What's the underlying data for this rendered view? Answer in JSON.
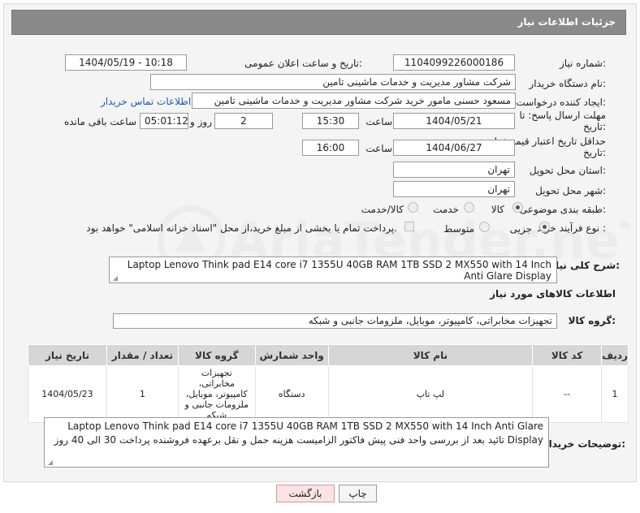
{
  "header": {
    "title": "جزئیات اطلاعات نیاز"
  },
  "labels": {
    "need_number": "شماره نیاز:",
    "announce_datetime": "تاریخ و ساعت اعلان عمومی:",
    "buyer_org": "نام دستگاه خریدار:",
    "requester": "ایجاد کننده درخواست:",
    "reply_deadline": "مهلت ارسال پاسخ: تا تاریخ:",
    "price_validity": "حداقل تاریخ اعتبار قیمت: تا تاریخ:",
    "time": "ساعت",
    "days_and": "روز و",
    "hours_remaining": "ساعت باقی مانده",
    "delivery_province": "استان محل تحویل:",
    "delivery_city": "شهر محل تحویل:",
    "category": "طبقه بندی موضوعی:",
    "purchase_type": "نوع فرآیند خرید :",
    "general_desc": "شرح کلی نیاز:",
    "goods_info": "اطلاعات کالاهای مورد نیاز",
    "goods_group": "گروه کالا:",
    "buyer_notes": "توضیحات خریدار:"
  },
  "values": {
    "need_number": "1104099226000186",
    "announce_datetime": "1404/05/19 - 10:18",
    "buyer_org": "شرکت مشاور مدیریت و خدمات ماشینی تامین",
    "requester": "مسعود حسنی مامور خرید شرکت مشاور مدیریت و خدمات ماشینی تامین",
    "contact_link": "اطلاعات تماس خریدار",
    "reply_date": "1404/05/21",
    "reply_time": "15:30",
    "days": "2",
    "remaining": "05:01:12",
    "validity_date": "1404/06/27",
    "validity_time": "16:00",
    "province": "تهران",
    "city": "تهران",
    "general_desc": "Laptop Lenovo Think pad E14 core i7 1355U 40GB RAM 1TB SSD 2 MX550 with 14 Inch Anti Glare Display",
    "goods_group": "تجهیزات مخابراتی، کامپیوتر، موبایل، ملزومات جانبی و شبکه",
    "buyer_notes": "Laptop Lenovo Think pad E14 core i7 1355U 40GB RAM 1TB SSD 2 MX550 with 14 Inch Anti Glare Display تائید بعد از بررسی واحد فنی  پیش فاکتور الزامیست هزینه حمل و نقل برعهده فروشنده  پرداخت 30 الی 40 روز"
  },
  "category_options": {
    "goods": "کالا",
    "service": "خدمت",
    "goods_service": "کالا/خدمت",
    "selected": "goods"
  },
  "purchase_options": {
    "minor": "جزیی",
    "medium": "متوسط",
    "selected": "minor"
  },
  "payment_note": "پرداخت تمام یا بخشی از مبلغ خرید،از محل \"اسناد خزانه اسلامی\" خواهد بود.",
  "table": {
    "headers": [
      "ردیف",
      "کد کالا",
      "نام کالا",
      "واحد شمارش",
      "گروه کالا",
      "تعداد / مقدار",
      "تاریخ نیاز"
    ],
    "rows": [
      [
        "1",
        "--",
        "لپ تاپ",
        "دستگاه",
        "تجهیزات مخابراتی، کامپیوتر، موبایل، ملزومات جانبی و شبکه",
        "1",
        "1404/05/23"
      ]
    ]
  },
  "buttons": {
    "print": "چاپ",
    "back": "بازگشت"
  },
  "watermark": "AriaTender.neT"
}
